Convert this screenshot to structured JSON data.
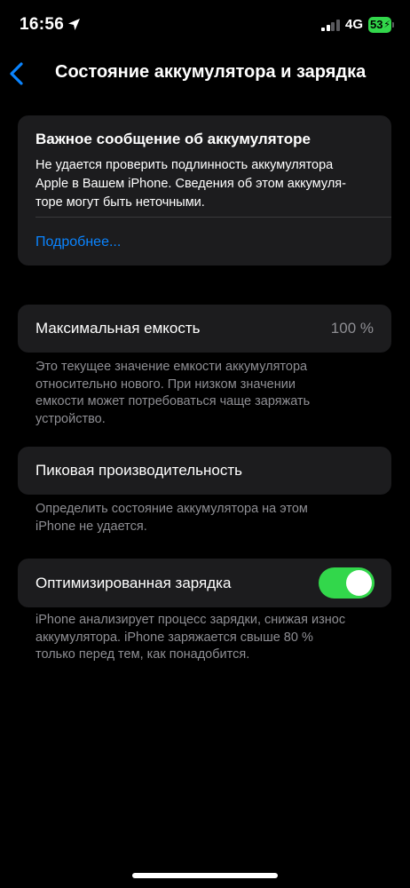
{
  "status_bar": {
    "time": "16:56",
    "network": "4G",
    "battery": "53",
    "icons": {
      "location": "location-arrow-icon",
      "signal": "cellular-signal-icon",
      "battery": "battery-charging-icon"
    }
  },
  "nav": {
    "back_icon": "chevron-left-icon",
    "title": "Состояние аккумулятора и зарядка"
  },
  "alert": {
    "title": "Важное сообщение об аккумуляторе",
    "body_lines": [
      "Не удается проверить подлинность аккумулятора",
      "Apple в Вашем iPhone. Сведения об этом аккуму­ля-",
      "торе могут быть неточными."
    ],
    "link": "Подробнее..."
  },
  "max_capacity": {
    "label": "Максимальная емкость",
    "value": "100 %",
    "footnote_lines": [
      "Это текущее значение емкости аккумулятора",
      "относительно нового. При низком значении",
      "емкости может потребоваться чаще заряжать",
      "устройство."
    ]
  },
  "peak_performance": {
    "label": "Пиковая производительность",
    "footnote_lines": [
      "Определить состояние аккумулятора на этом",
      "iPhone не удается."
    ]
  },
  "optimized_charging": {
    "label": "Оптимизированная зарядка",
    "enabled": true,
    "footnote_lines": [
      "iPhone анализирует процесс зарядки, снижая износ",
      "аккумулятора. iPhone заряжается свыше 80 %",
      "только перед тем, как понадобится."
    ]
  },
  "colors": {
    "background": "#000000",
    "card": "#1c1c1e",
    "accent": "#0a84ff",
    "toggle_on": "#32d74b",
    "secondary_text": "#8e8e93"
  }
}
